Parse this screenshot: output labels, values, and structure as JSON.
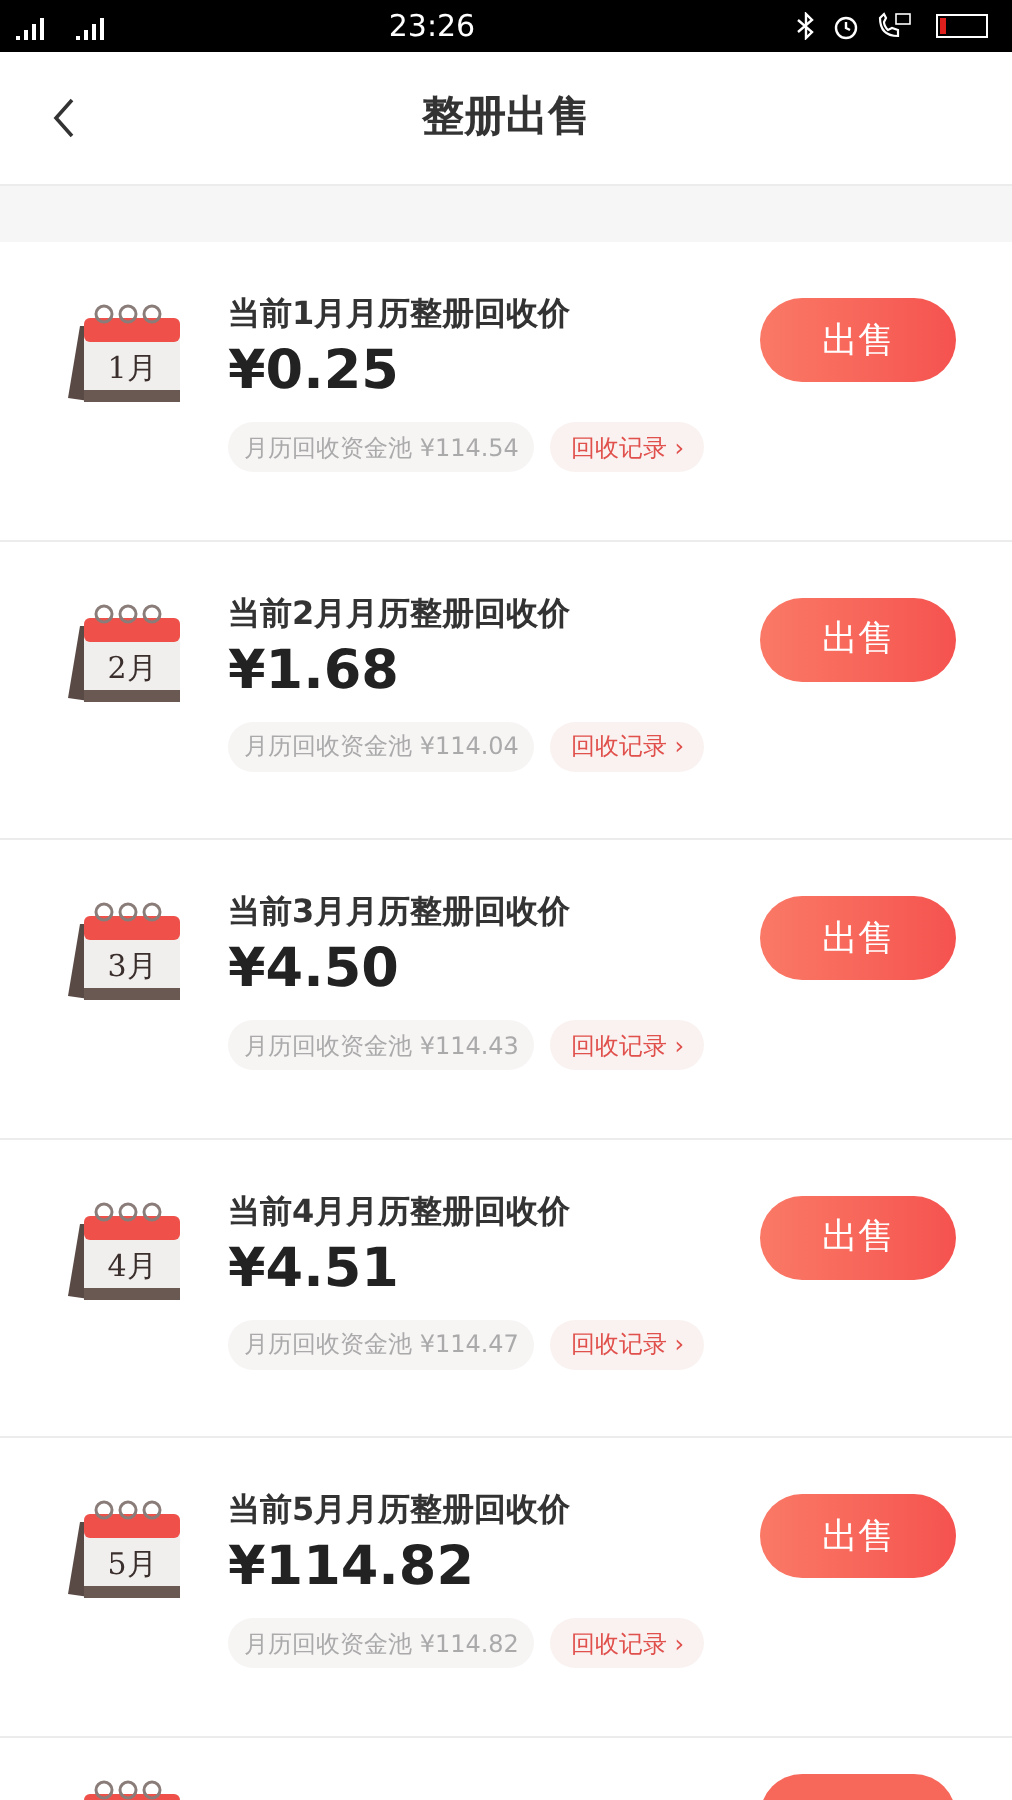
{
  "status_bar": {
    "time": "23:26"
  },
  "header": {
    "title": "整册出售"
  },
  "items": [
    {
      "calendar_label": "1月",
      "title": "当前1月月历整册回收价",
      "price": "¥0.25",
      "pool": "月历回收资金池 ¥114.54",
      "record": "回收记录 ›",
      "button": "出售"
    },
    {
      "calendar_label": "2月",
      "title": "当前2月月历整册回收价",
      "price": "¥1.68",
      "pool": "月历回收资金池 ¥114.04",
      "record": "回收记录 ›",
      "button": "出售"
    },
    {
      "calendar_label": "3月",
      "title": "当前3月月历整册回收价",
      "price": "¥4.50",
      "pool": "月历回收资金池 ¥114.43",
      "record": "回收记录 ›",
      "button": "出售"
    },
    {
      "calendar_label": "4月",
      "title": "当前4月月历整册回收价",
      "price": "¥4.51",
      "pool": "月历回收资金池 ¥114.47",
      "record": "回收记录 ›",
      "button": "出售"
    },
    {
      "calendar_label": "5月",
      "title": "当前5月月历整册回收价",
      "price": "¥114.82",
      "pool": "月历回收资金池 ¥114.82",
      "record": "回收记录 ›",
      "button": "出售"
    }
  ]
}
